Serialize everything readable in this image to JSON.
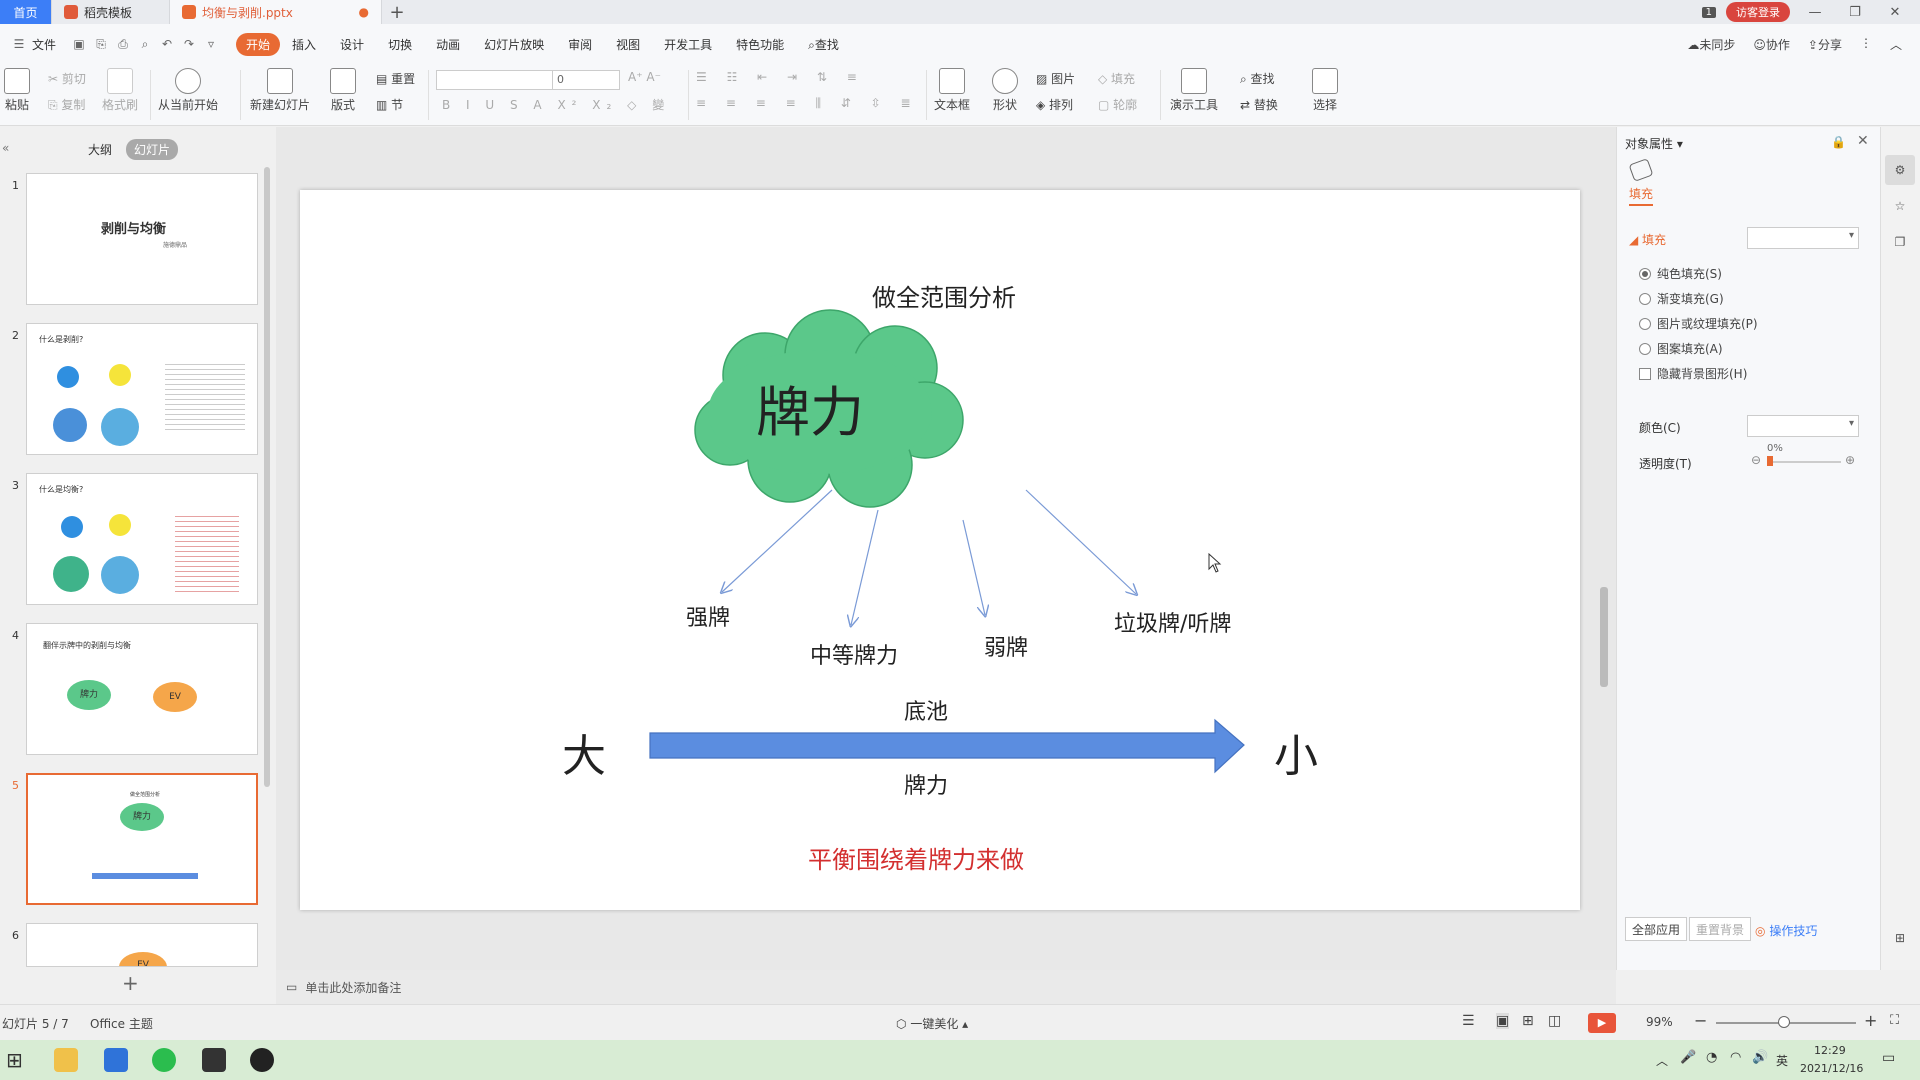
{
  "tabs": {
    "home": "首页",
    "template": "稻壳模板",
    "file": "均衡与剥削.pptx",
    "badge": "1",
    "visitor": "访客登录"
  },
  "menu": {
    "file": "文件",
    "items": [
      "开始",
      "插入",
      "设计",
      "切换",
      "动画",
      "幻灯片放映",
      "审阅",
      "视图",
      "开发工具",
      "特色功能"
    ],
    "search": "查找",
    "right": [
      "未同步",
      "协作",
      "分享"
    ]
  },
  "ribbon": {
    "paste": "粘贴",
    "cut": "剪切",
    "copy": "复制",
    "format_painter": "格式刷",
    "from_current": "从当前开始",
    "new_slide": "新建幻灯片",
    "layout": "版式",
    "reset": "重置",
    "section": "节",
    "font_size": "0",
    "textbox": "文本框",
    "shape": "形状",
    "picture": "图片",
    "arrange": "排列",
    "fill": "填充",
    "outline": "轮廓",
    "present_tools": "演示工具",
    "find": "查找",
    "replace": "替换",
    "select": "选择"
  },
  "leftpanel": {
    "tab_outline": "大纲",
    "tab_slides": "幻灯片",
    "thumbs": [
      {
        "num": "1",
        "title": "剥削与均衡",
        "sub": "施德鼎品"
      },
      {
        "num": "2",
        "title": "什么是剥削?"
      },
      {
        "num": "3",
        "title": "什么是均衡?"
      },
      {
        "num": "4",
        "title": "翻伴示牌中的剥削与均衡",
        "c1": "牌力",
        "c2": "EV"
      },
      {
        "num": "5",
        "title": "做全范围分析",
        "cloud": "牌力"
      },
      {
        "num": "6",
        "cloud": "EV"
      }
    ]
  },
  "slide": {
    "title": "做全范围分析",
    "cloud": "牌力",
    "labels": [
      "强牌",
      "中等牌力",
      "弱牌",
      "垃圾牌/听牌"
    ],
    "big": "大",
    "small": "小",
    "above_arrow": "底池",
    "below_arrow": "牌力",
    "conclusion": "平衡围绕着牌力来做",
    "cloud_color": "#5bc88a",
    "arrow_color": "#5b8de0",
    "conclusion_color": "#d32f2f"
  },
  "rightpanel": {
    "title": "对象属性",
    "fill_tab": "填充",
    "section": "填充",
    "options": [
      "纯色填充(S)",
      "渐变填充(G)",
      "图片或纹理填充(P)",
      "图案填充(A)"
    ],
    "hide_bg": "隐藏背景图形(H)",
    "color": "颜色(C)",
    "transparency": "透明度(T)",
    "transparency_value": "0%",
    "apply_all": "全部应用",
    "reset_bg": "重置背景",
    "tips": "操作技巧"
  },
  "notes": "单击此处添加备注",
  "status": {
    "slide": "幻灯片 5 / 7",
    "theme": "Office 主题",
    "beautify": "一键美化",
    "zoom": "99%"
  },
  "taskbar": {
    "time": "12:29",
    "date": "2021/12/16",
    "ime": "英"
  }
}
